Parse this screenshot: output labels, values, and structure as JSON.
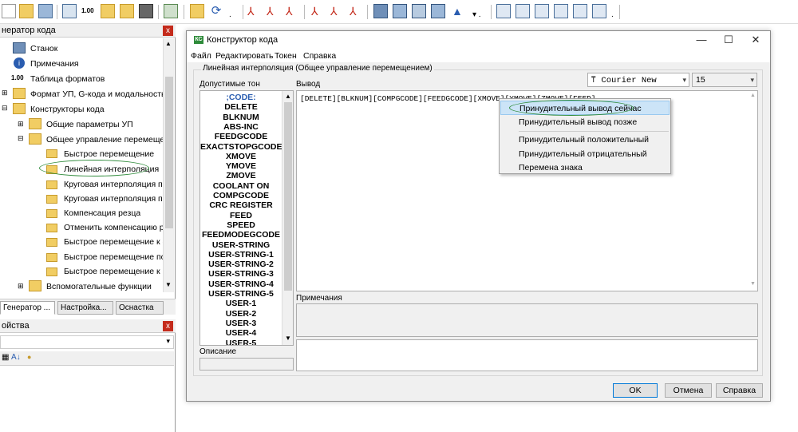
{
  "left_panel": {
    "title": "нератор кода",
    "close": "x",
    "tree": [
      {
        "label": "Станок"
      },
      {
        "label": "Примечания"
      },
      {
        "label": "Таблица форматов",
        "icon_text": "1.00"
      },
      {
        "label": "Формат УП, G-кода и модальность"
      },
      {
        "label": "Конструкторы кода"
      },
      {
        "label": "Общие параметры УП"
      },
      {
        "label": "Общее управление перемещение"
      },
      {
        "label": "Быстрое перемещение"
      },
      {
        "label": "Линейная интерполяция"
      },
      {
        "label": "Круговая интерполяция по ча"
      },
      {
        "label": "Круговая интерполяция прот"
      },
      {
        "label": "Компенсация резца"
      },
      {
        "label": "Отменить компенсацию резц"
      },
      {
        "label": "Быстрое перемещение к сме"
      },
      {
        "label": "Быстрое перемещение после"
      },
      {
        "label": "Быстрое перемещение к исхо"
      },
      {
        "label": "Вспомогательные функции"
      }
    ],
    "tabs": [
      "Генератор ...",
      "Настройка...",
      "Оснастка"
    ]
  },
  "props_panel": {
    "title": "ойства",
    "close": "x"
  },
  "dialog": {
    "title": "Конструктор кода",
    "icon_text": "КС",
    "menu": [
      "Файл",
      "Редактировать",
      "Токен",
      "Справка"
    ],
    "group_label": "Линейная интерполяция (Общее управление перемещением)",
    "allowed_tokens_label": "Допустимые тон",
    "output_label": "Вывод",
    "font_name": "Courier New",
    "font_size": "15",
    "tokens": [
      ";CODE:",
      "DELETE",
      "BLKNUM",
      "ABS-INC",
      "FEEDGCODE",
      "EXACTSTOPGCODE",
      "XMOVE",
      "YMOVE",
      "ZMOVE",
      "COOLANT ON",
      "COMPGCODE",
      "CRC REGISTER",
      "FEED",
      "SPEED",
      "FEEDMODEGCODE",
      "USER-STRING",
      "USER-STRING-1",
      "USER-STRING-2",
      "USER-STRING-3",
      "USER-STRING-4",
      "USER-STRING-5",
      "USER-1",
      "USER-2",
      "USER-3",
      "USER-4",
      "USER-5"
    ],
    "output_text": "[DELETE][BLKNUM][COMPGCODE][FEEDGCODE][XMOVE][YMOVE][ZMOVE][FEED]",
    "notes_label": "Примечания",
    "description_label": "Описание",
    "buttons": {
      "ok": "OK",
      "cancel": "Отмена",
      "help": "Справка"
    },
    "context_menu": [
      "Принудительный вывод сейчас",
      "Принудительный вывод позже",
      "Принудительный положительный",
      "Принудительный отрицательный",
      "Перемена знака"
    ],
    "window_controls": {
      "minimize": "—",
      "maximize": "☐",
      "close": "✕"
    }
  },
  "colors": {
    "highlight": "#cce4f7",
    "close_red": "#c42b1c",
    "annotation_green": "#2e8b3a"
  }
}
